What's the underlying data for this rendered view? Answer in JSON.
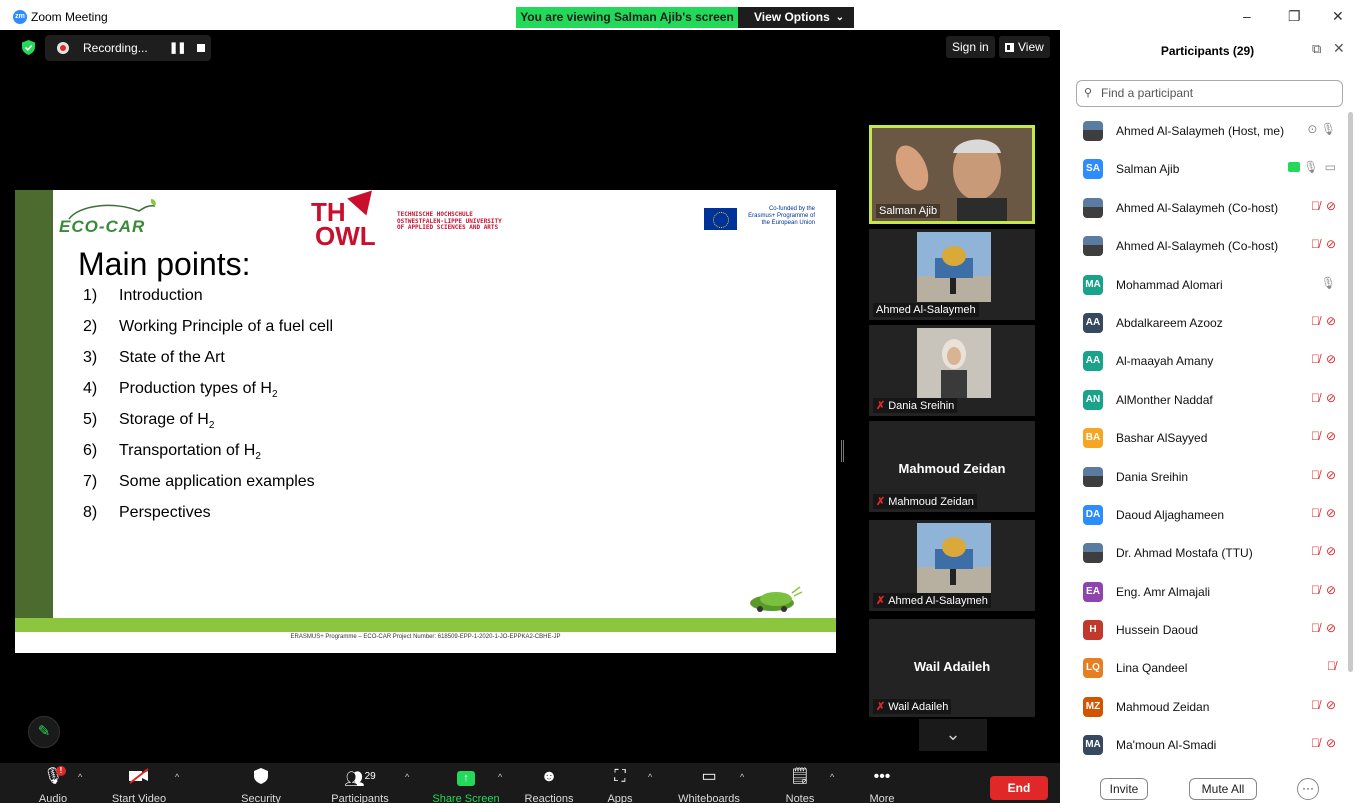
{
  "window": {
    "title": "Zoom Meeting",
    "logo": "zm",
    "controls": {
      "minimize": "–",
      "restore": "❐",
      "close": "✕"
    }
  },
  "banner": {
    "viewing_text": "You are viewing Salman Ajib's screen",
    "view_options_label": "View Options"
  },
  "top_bar": {
    "recording_label": "Recording...",
    "sign_in_label": "Sign in",
    "view_label": "View"
  },
  "slide": {
    "eco_logo_text": "ECO-CAR",
    "th_logo_text": "TH",
    "owl_text": "OWL",
    "th_subtitle": "TECHNISCHE HOCHSCHULE OSTWESTFALEN-LIPPE UNIVERSITY OF APPLIED SCIENCES AND ARTS",
    "eu_text": "Co-funded by the Erasmus+ Programme of the European Union",
    "title": "Main points:",
    "points": [
      {
        "num": "1)",
        "text": "Introduction",
        "sub": ""
      },
      {
        "num": "2)",
        "text": "Working Principle of a fuel cell",
        "sub": ""
      },
      {
        "num": "3)",
        "text": "State of the Art",
        "sub": ""
      },
      {
        "num": "4)",
        "text": "Production types of H",
        "sub": "2"
      },
      {
        "num": "5)",
        "text": "Storage of H",
        "sub": "2"
      },
      {
        "num": "6)",
        "text": "Transportation of H",
        "sub": "2"
      },
      {
        "num": "7)",
        "text": "Some application examples",
        "sub": ""
      },
      {
        "num": "8)",
        "text": "Perspectives",
        "sub": ""
      }
    ],
    "footer": "ERASMUS+ Programme – ECO-CAR Project Number: 618509-EPP-1-2020-1-JO-EPPKA2-CBHE-JP"
  },
  "tiles": [
    {
      "name": "Salman Ajib",
      "muted": false,
      "type": "video"
    },
    {
      "name": "Ahmed Al-Salaymeh",
      "muted": false,
      "type": "photo"
    },
    {
      "name": "Dania Sreihin",
      "muted": true,
      "type": "photo"
    },
    {
      "name": "Mahmoud Zeidan",
      "muted": true,
      "type": "name",
      "center_name": "Mahmoud Zeidan"
    },
    {
      "name": "Ahmed Al-Salaymeh",
      "muted": true,
      "type": "photo"
    },
    {
      "name": "Wail Adaileh",
      "muted": true,
      "type": "name",
      "center_name": "Wail Adaileh"
    }
  ],
  "toolbar": {
    "audio": "Audio",
    "start_video": "Start Video",
    "security": "Security",
    "participants": "Participants",
    "participants_count": "29",
    "share_screen": "Share Screen",
    "reactions": "Reactions",
    "apps": "Apps",
    "whiteboards": "Whiteboards",
    "notes": "Notes",
    "more": "More",
    "end": "End",
    "audio_badge": "!"
  },
  "panel": {
    "title": "Participants (29)",
    "search_placeholder": "Find a participant",
    "participants": [
      {
        "name": "Ahmed Al-Salaymeh (Host, me)",
        "initials": "",
        "color": "",
        "mic": "on-gray",
        "video": "rec"
      },
      {
        "name": "Salman Ajib",
        "initials": "SA",
        "color": "#2d8cff",
        "mic": "on",
        "video": "on",
        "sharing": true
      },
      {
        "name": "Ahmed Al-Salaymeh (Co-host)",
        "initials": "",
        "color": "",
        "mic": "off",
        "video": "off"
      },
      {
        "name": "Ahmed Al-Salaymeh (Co-host)",
        "initials": "",
        "color": "",
        "mic": "off",
        "video": "off"
      },
      {
        "name": "Mohammad Alomari",
        "initials": "MA",
        "color": "#1aa38b",
        "mic": "on-gray",
        "video": "none"
      },
      {
        "name": "Abdalkareem Azooz",
        "initials": "AA",
        "color": "#36495e",
        "mic": "off",
        "video": "off"
      },
      {
        "name": "Al-maayah Amany",
        "initials": "AA",
        "color": "#1aa38b",
        "mic": "off",
        "video": "off"
      },
      {
        "name": "AlMonther Naddaf",
        "initials": "AN",
        "color": "#1aa38b",
        "mic": "off",
        "video": "off"
      },
      {
        "name": "Bashar AlSayyed",
        "initials": "BA",
        "color": "#f5a623",
        "mic": "off",
        "video": "off"
      },
      {
        "name": "Dania Sreihin",
        "initials": "",
        "color": "",
        "mic": "off",
        "video": "off"
      },
      {
        "name": "Daoud Aljaghameen",
        "initials": "DA",
        "color": "#2d8cff",
        "mic": "off",
        "video": "off"
      },
      {
        "name": "Dr. Ahmad Mostafa (TTU)",
        "initials": "",
        "color": "",
        "mic": "off",
        "video": "off"
      },
      {
        "name": "Eng. Amr Almajali",
        "initials": "EA",
        "color": "#8e44ad",
        "mic": "off",
        "video": "off"
      },
      {
        "name": "Hussein Daoud",
        "initials": "H",
        "color": "#c0392b",
        "mic": "off",
        "video": "off"
      },
      {
        "name": "Lina Qandeel",
        "initials": "LQ",
        "color": "#e67e22",
        "mic": "off",
        "video": "none"
      },
      {
        "name": "Mahmoud Zeidan",
        "initials": "MZ",
        "color": "#d35400",
        "mic": "off",
        "video": "off"
      },
      {
        "name": "Ma'moun Al-Smadi",
        "initials": "MA",
        "color": "#36495e",
        "mic": "off",
        "video": "off"
      }
    ],
    "invite_label": "Invite",
    "mute_all_label": "Mute All",
    "more_label": "···"
  }
}
